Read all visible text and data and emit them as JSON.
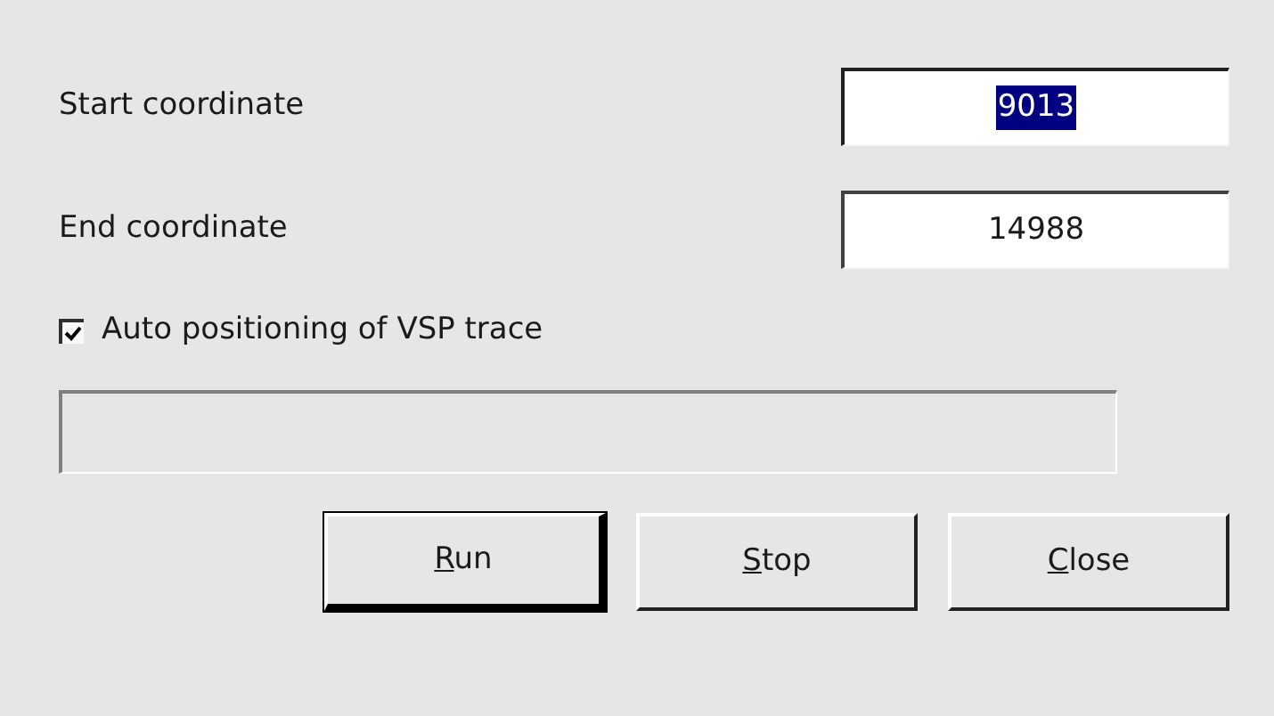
{
  "fields": [
    {
      "label": "Start coordinate",
      "value": "9013",
      "text_selected": true,
      "focused": true
    },
    {
      "label": "End coordinate",
      "value": "14988",
      "text_selected": false,
      "focused": false
    }
  ],
  "auto_positioning": {
    "label": "Auto positioning of VSP trace",
    "checked": true
  },
  "progress": {
    "level": 0
  },
  "buttons": [
    {
      "label": "Run",
      "default": true
    },
    {
      "label": "Stop",
      "default": false
    },
    {
      "label": "Close",
      "default": false
    }
  ]
}
